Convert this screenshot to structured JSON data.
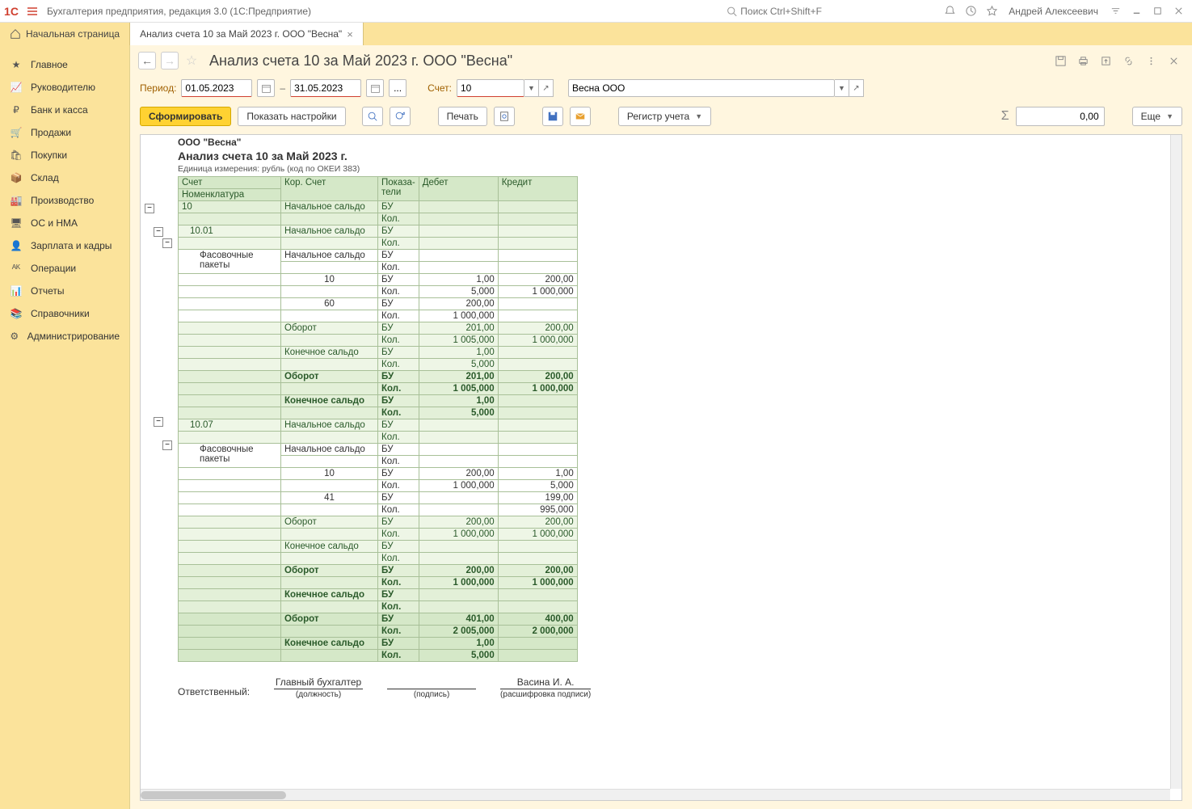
{
  "titlebar": {
    "app_title": "Бухгалтерия предприятия, редакция 3.0  (1С:Предприятие)",
    "search_placeholder": "Поиск Ctrl+Shift+F",
    "user": "Андрей Алексеевич"
  },
  "tabs": {
    "home": "Начальная страница",
    "active": "Анализ счета 10 за Май 2023 г. ООО \"Весна\""
  },
  "sidebar": [
    "Главное",
    "Руководителю",
    "Банк и касса",
    "Продажи",
    "Покупки",
    "Склад",
    "Производство",
    "ОС и НМА",
    "Зарплата и кадры",
    "Операции",
    "Отчеты",
    "Справочники",
    "Администрирование"
  ],
  "page_title": "Анализ счета 10 за Май 2023 г. ООО \"Весна\"",
  "filters": {
    "period_label": "Период:",
    "date_from": "01.05.2023",
    "date_to": "31.05.2023",
    "account_label": "Счет:",
    "account": "10",
    "org": "Весна ООО"
  },
  "toolbar": {
    "form": "Сформировать",
    "settings": "Показать настройки",
    "print": "Печать",
    "register": "Регистр учета",
    "more": "Еще",
    "total": "0,00"
  },
  "report": {
    "org": "ООО \"Весна\"",
    "title": "Анализ счета 10 за Май 2023 г.",
    "unit": "Единица измерения: рубль (код по ОКЕИ 383)",
    "hdr": {
      "acct": "Счет",
      "nomen": "Номенклатура",
      "kor": "Кор. Счет",
      "ind": "Показа-\nтели",
      "debit": "Дебет",
      "credit": "Кредит"
    },
    "ind": {
      "bu": "БУ",
      "kol": "Кол."
    },
    "lbl": {
      "start": "Начальное сальдо",
      "turn": "Оборот",
      "end": "Конечное сальдо",
      "packets": "Фасовочные пакеты"
    },
    "sign": {
      "resp": "Ответственный:",
      "pos_val": "Главный бухгалтер",
      "pos_lbl": "(должность)",
      "sig_lbl": "(подпись)",
      "name_val": "Васина И. А.",
      "name_lbl": "(расшифровка подписи)"
    },
    "rows": [
      {
        "lvl": 1,
        "acct": "10",
        "kor": "Начальное сальдо",
        "ind": "БУ"
      },
      {
        "lvl": 1,
        "kor": "",
        "ind": "Кол."
      },
      {
        "lvl": 2,
        "acct": "10.01",
        "kor": "Начальное сальдо",
        "ind": "БУ",
        "indent": 1
      },
      {
        "lvl": 2,
        "ind": "Кол."
      },
      {
        "lvl": 3,
        "acct": "Фасовочные пакеты",
        "kor": "Начальное сальдо",
        "ind": "БУ",
        "indent": 2,
        "rows2": true
      },
      {
        "lvl": 3,
        "ind": "Кол."
      },
      {
        "lvl": 3,
        "kor": "10",
        "ind": "БУ",
        "deb": "1,00",
        "cre": "200,00"
      },
      {
        "lvl": 3,
        "ind": "Кол.",
        "deb": "5,000",
        "cre": "1 000,000"
      },
      {
        "lvl": 3,
        "kor": "60",
        "ind": "БУ",
        "deb": "200,00"
      },
      {
        "lvl": 3,
        "ind": "Кол.",
        "deb": "1 000,000"
      },
      {
        "lvl": 3,
        "kor": "Оборот",
        "ind": "БУ",
        "deb": "201,00",
        "cre": "200,00",
        "bg": 2
      },
      {
        "lvl": 3,
        "ind": "Кол.",
        "deb": "1 005,000",
        "cre": "1 000,000",
        "bg": 2
      },
      {
        "lvl": 3,
        "kor": "Конечное сальдо",
        "ind": "БУ",
        "deb": "1,00",
        "bg": 2
      },
      {
        "lvl": 3,
        "ind": "Кол.",
        "deb": "5,000",
        "bg": 2
      },
      {
        "lvl": 1,
        "kor": "Оборот",
        "ind": "БУ",
        "deb": "201,00",
        "cre": "200,00",
        "bold": true
      },
      {
        "lvl": 1,
        "ind": "Кол.",
        "deb": "1 005,000",
        "cre": "1 000,000",
        "bold": true
      },
      {
        "lvl": 1,
        "kor": "Конечное сальдо",
        "ind": "БУ",
        "deb": "1,00",
        "bold": true
      },
      {
        "lvl": 1,
        "ind": "Кол.",
        "deb": "5,000",
        "bold": true
      },
      {
        "lvl": 2,
        "acct": "10.07",
        "kor": "Начальное сальдо",
        "ind": "БУ",
        "indent": 1
      },
      {
        "lvl": 2,
        "ind": "Кол."
      },
      {
        "lvl": 3,
        "acct": "Фасовочные пакеты",
        "kor": "Начальное сальдо",
        "ind": "БУ",
        "indent": 2,
        "rows2": true
      },
      {
        "lvl": 3,
        "ind": "Кол."
      },
      {
        "lvl": 3,
        "kor": "10",
        "ind": "БУ",
        "deb": "200,00",
        "cre": "1,00"
      },
      {
        "lvl": 3,
        "ind": "Кол.",
        "deb": "1 000,000",
        "cre": "5,000"
      },
      {
        "lvl": 3,
        "kor": "41",
        "ind": "БУ",
        "cre": "199,00"
      },
      {
        "lvl": 3,
        "ind": "Кол.",
        "cre": "995,000"
      },
      {
        "lvl": 3,
        "kor": "Оборот",
        "ind": "БУ",
        "deb": "200,00",
        "cre": "200,00",
        "bg": 2
      },
      {
        "lvl": 3,
        "ind": "Кол.",
        "deb": "1 000,000",
        "cre": "1 000,000",
        "bg": 2
      },
      {
        "lvl": 3,
        "kor": "Конечное сальдо",
        "ind": "БУ",
        "bg": 2
      },
      {
        "lvl": 3,
        "ind": "Кол.",
        "bg": 2
      },
      {
        "lvl": 1,
        "kor": "Оборот",
        "ind": "БУ",
        "deb": "200,00",
        "cre": "200,00",
        "bold": true
      },
      {
        "lvl": 1,
        "ind": "Кол.",
        "deb": "1 000,000",
        "cre": "1 000,000",
        "bold": true
      },
      {
        "lvl": 1,
        "kor": "Конечное сальдо",
        "ind": "БУ",
        "bold": true
      },
      {
        "lvl": 1,
        "ind": "Кол.",
        "bold": true
      },
      {
        "lvl": 0,
        "kor": "Оборот",
        "ind": "БУ",
        "deb": "401,00",
        "cre": "400,00",
        "bold": true
      },
      {
        "lvl": 0,
        "ind": "Кол.",
        "deb": "2 005,000",
        "cre": "2 000,000",
        "bold": true
      },
      {
        "lvl": 0,
        "kor": "Конечное сальдо",
        "ind": "БУ",
        "deb": "1,00",
        "bold": true
      },
      {
        "lvl": 0,
        "ind": "Кол.",
        "deb": "5,000",
        "bold": true
      }
    ]
  }
}
